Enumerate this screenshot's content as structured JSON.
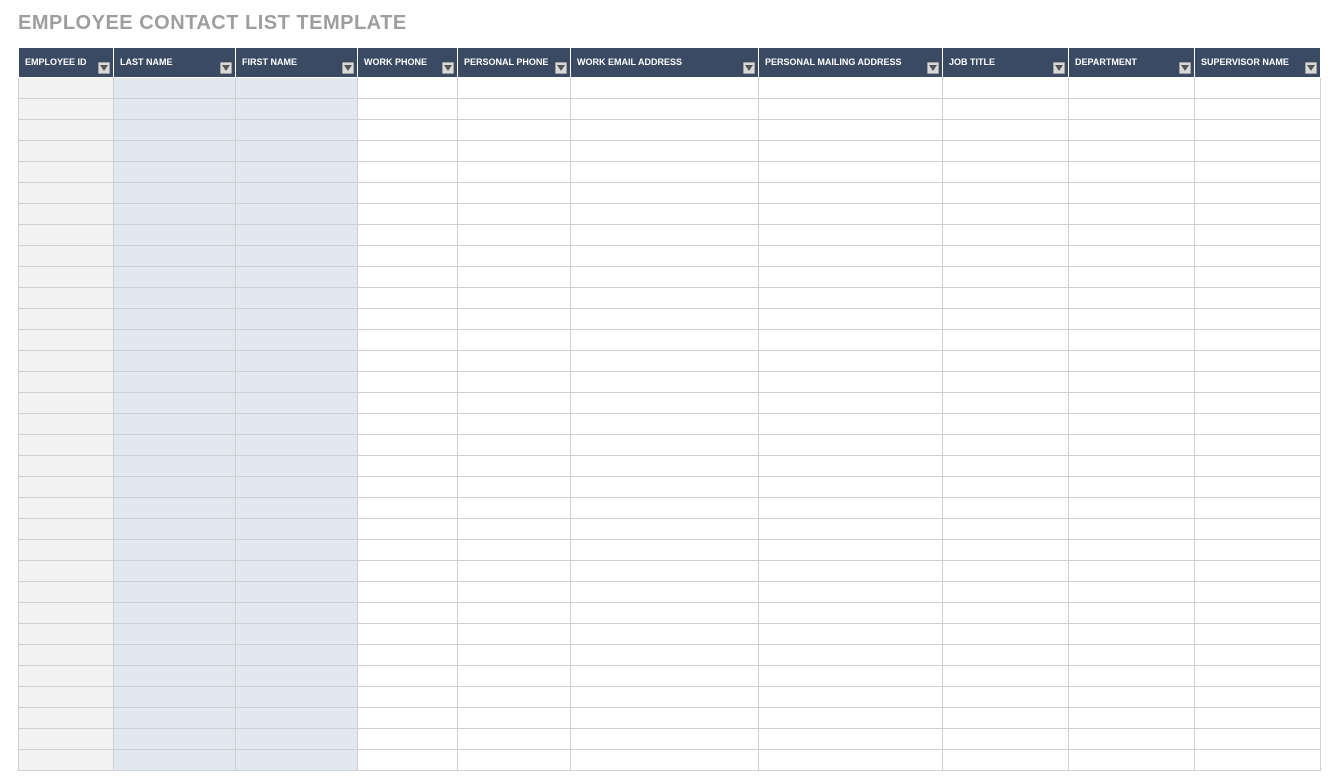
{
  "title": "EMPLOYEE CONTACT LIST TEMPLATE",
  "columns": [
    "EMPLOYEE ID",
    "LAST NAME",
    "FIRST NAME",
    "WORK PHONE",
    "PERSONAL PHONE",
    "WORK EMAIL ADDRESS",
    "PERSONAL MAILING ADDRESS",
    "JOB TITLE",
    "DEPARTMENT",
    "SUPERVISOR NAME"
  ],
  "rowCount": 33
}
